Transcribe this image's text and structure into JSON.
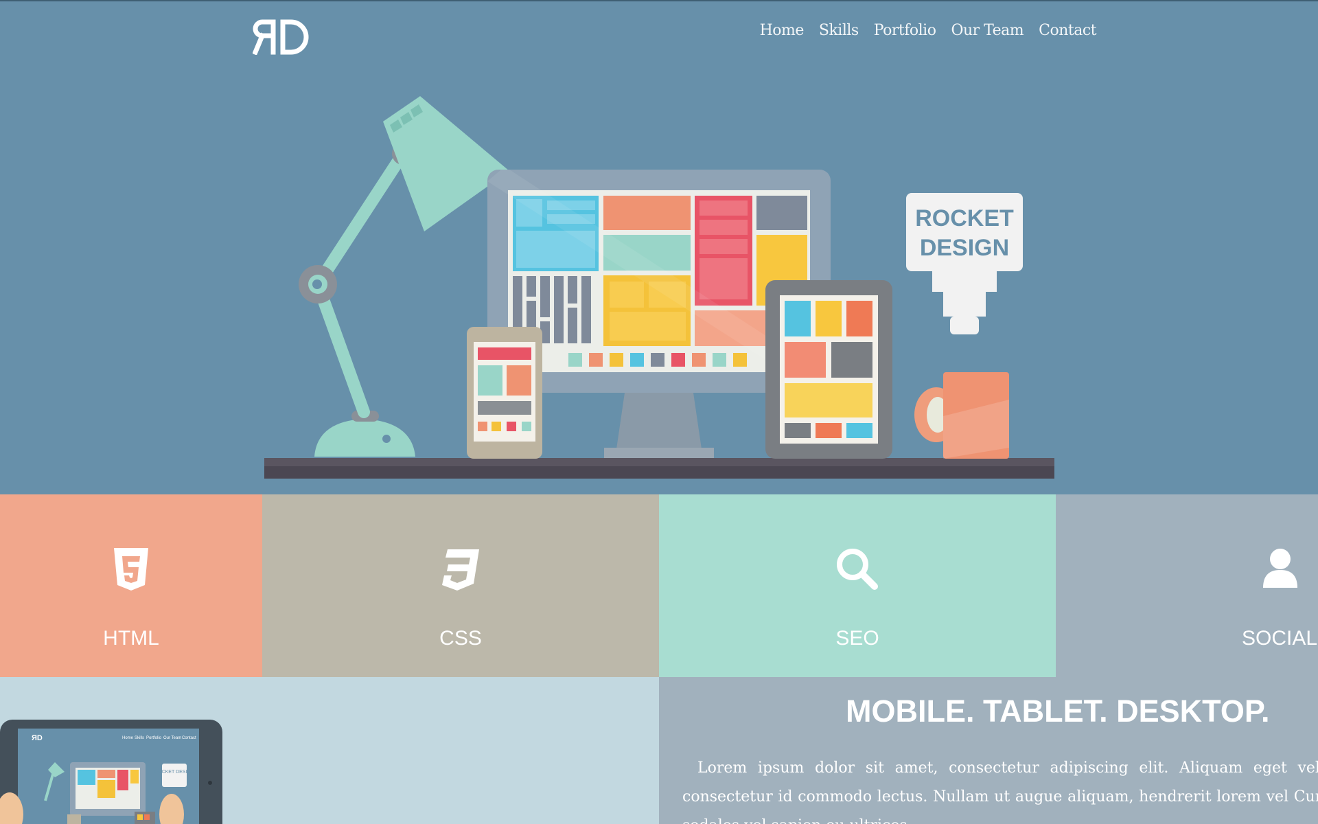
{
  "brand": {
    "logo_text": "ЯD"
  },
  "nav": {
    "items": [
      "Home",
      "Skills",
      "Portfolio",
      "Our Team",
      "Contact"
    ]
  },
  "hero": {
    "sign_line1": "ROCKET",
    "sign_line2": "DESIGN"
  },
  "tiles": [
    {
      "label": "HTML",
      "icon": "html5-icon",
      "color": "#f1a78c"
    },
    {
      "label": "CSS",
      "icon": "css3-icon",
      "color": "#bcb8aa"
    },
    {
      "label": "SEO",
      "icon": "search-icon",
      "color": "#a8ddd1"
    },
    {
      "label": "SOCIAL",
      "icon": "user-icon",
      "color": "#a1b1bd"
    }
  ],
  "feature": {
    "title": "MOBILE. TABLET. DESKTOP.",
    "text": "Lorem ipsum dolor sit amet, consectetur adipiscing elit. Aliquam eget velit nec consectetur id commodo lectus. Nullam ut augue aliquam, hendrerit lorem vel Curabitur sodales vel sapien eu ultrices."
  },
  "preview": {
    "nav_items": [
      "Home",
      "Skills",
      "Portfolio",
      "Our Team",
      "Contact"
    ],
    "sign": "ROCKET DESIGN"
  }
}
